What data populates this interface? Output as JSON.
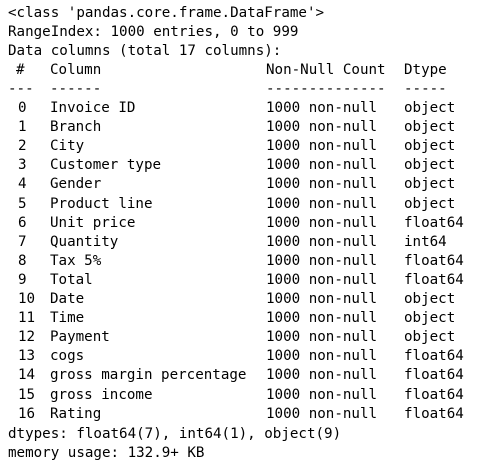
{
  "info": {
    "class_line": "<class 'pandas.core.frame.DataFrame'>",
    "range_index": "RangeIndex: 1000 entries, 0 to 999",
    "data_columns": "Data columns (total 17 columns):",
    "header": {
      "idx": "#",
      "column": "Column",
      "count": "Non-Null Count",
      "dtype": "Dtype"
    },
    "separator": {
      "idx": "---",
      "column": "------",
      "count": "--------------",
      "dtype": "-----"
    },
    "rows": [
      {
        "idx": "0",
        "column": "Invoice ID",
        "count": "1000 non-null",
        "dtype": "object"
      },
      {
        "idx": "1",
        "column": "Branch",
        "count": "1000 non-null",
        "dtype": "object"
      },
      {
        "idx": "2",
        "column": "City",
        "count": "1000 non-null",
        "dtype": "object"
      },
      {
        "idx": "3",
        "column": "Customer type",
        "count": "1000 non-null",
        "dtype": "object"
      },
      {
        "idx": "4",
        "column": "Gender",
        "count": "1000 non-null",
        "dtype": "object"
      },
      {
        "idx": "5",
        "column": "Product line",
        "count": "1000 non-null",
        "dtype": "object"
      },
      {
        "idx": "6",
        "column": "Unit price",
        "count": "1000 non-null",
        "dtype": "float64"
      },
      {
        "idx": "7",
        "column": "Quantity",
        "count": "1000 non-null",
        "dtype": "int64"
      },
      {
        "idx": "8",
        "column": "Tax 5%",
        "count": "1000 non-null",
        "dtype": "float64"
      },
      {
        "idx": "9",
        "column": "Total",
        "count": "1000 non-null",
        "dtype": "float64"
      },
      {
        "idx": "10",
        "column": "Date",
        "count": "1000 non-null",
        "dtype": "object"
      },
      {
        "idx": "11",
        "column": "Time",
        "count": "1000 non-null",
        "dtype": "object"
      },
      {
        "idx": "12",
        "column": "Payment",
        "count": "1000 non-null",
        "dtype": "object"
      },
      {
        "idx": "13",
        "column": "cogs",
        "count": "1000 non-null",
        "dtype": "float64"
      },
      {
        "idx": "14",
        "column": "gross margin percentage",
        "count": "1000 non-null",
        "dtype": "float64"
      },
      {
        "idx": "15",
        "column": "gross income",
        "count": "1000 non-null",
        "dtype": "float64"
      },
      {
        "idx": "16",
        "column": "Rating",
        "count": "1000 non-null",
        "dtype": "float64"
      }
    ],
    "dtypes": "dtypes: float64(7), int64(1), object(9)",
    "memory": "memory usage: 132.9+ KB"
  }
}
